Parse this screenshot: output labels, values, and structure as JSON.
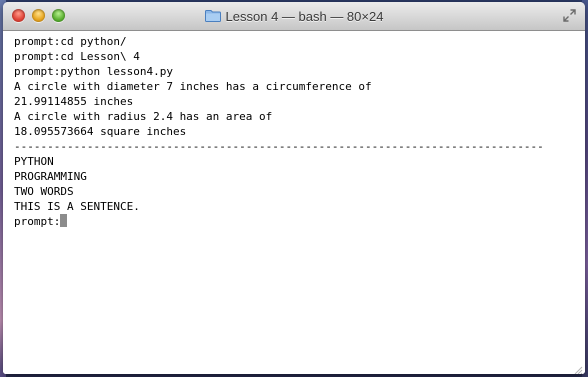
{
  "window": {
    "title": "Lesson 4 — bash — 80×24",
    "title_icon": "folder-icon",
    "buttons": {
      "close": "close-button",
      "minimize": "minimize-button",
      "zoom": "zoom-button",
      "fullscreen": "fullscreen-icon"
    }
  },
  "terminal": {
    "lines": [
      "prompt:cd python/",
      "prompt:cd Lesson\\ 4",
      "prompt:python lesson4.py",
      "A circle with diameter 7 inches has a circumference of",
      "21.99114855 inches",
      "A circle with radius 2.4 has an area of",
      "18.095573664 square inches"
    ],
    "separator": "--------------------------------------------------------------------------------",
    "lines_after": [
      "PYTHON",
      "PROGRAMMING",
      "TWO WORDS",
      "THIS IS A SENTENCE."
    ],
    "prompt": "prompt:"
  },
  "colors": {
    "terminal_background": "#ffffff",
    "terminal_text": "#000000",
    "cursor": "#8c8c8c",
    "close": "#e2463a",
    "minimize": "#e9a823",
    "zoom": "#5fb334"
  }
}
